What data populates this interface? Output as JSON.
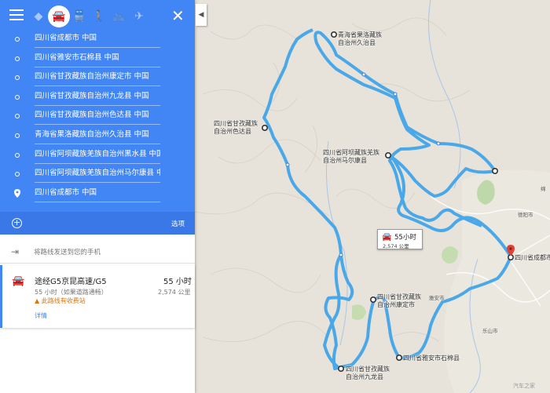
{
  "sidebar": {
    "close_label": "✕",
    "travel_modes": [
      {
        "name": "best",
        "icon": "diamond-route-icon"
      },
      {
        "name": "drive",
        "icon": "car-icon"
      },
      {
        "name": "transit",
        "icon": "train-icon"
      },
      {
        "name": "walk",
        "icon": "walk-icon"
      },
      {
        "name": "bike",
        "icon": "bike-icon"
      },
      {
        "name": "flight",
        "icon": "plane-icon"
      }
    ],
    "stops": [
      "四川省成都市 中国",
      "四川省雅安市石棉县 中国",
      "四川省甘孜藏族自治州康定市 中国",
      "四川省甘孜藏族自治州九龙县 中国",
      "四川省甘孜藏族自治州色达县 中国",
      "青海省果洛藏族自治州久治县 中国",
      "四川省阿坝藏族羌族自治州黑水县 中国",
      "四川省阿坝藏族羌族自治州马尔康县 中国",
      "四川省成都市 中国"
    ],
    "options_label": "选项",
    "send_label": "将路线发送到您的手机",
    "route": {
      "via": "途经G5京昆高速/G5",
      "duration": "55 小时",
      "traffic": "55 小时（如果道路通畅）",
      "distance": "2,574 公里",
      "warning": "此路线有收费站",
      "details": "详情"
    }
  },
  "map": {
    "info_time": "55小时",
    "info_distance": "2,574 公里",
    "places": [
      {
        "id": "jiuzhi",
        "line1": "青海省果洛藏族",
        "line2": "自治州久治县"
      },
      {
        "id": "seda",
        "line1": "四川省甘孜藏族",
        "line2": "自治州色达县"
      },
      {
        "id": "maerkang",
        "line1": "四川省阿坝藏族羌族",
        "line2": "自治州马尔康县"
      },
      {
        "id": "chengdu",
        "line1": "四川省成都市",
        "line2": ""
      },
      {
        "id": "kangding",
        "line1": "四川省甘孜藏族",
        "line2": "自治州康定市"
      },
      {
        "id": "shimian",
        "line1": "四川省雅安市石棉县",
        "line2": ""
      },
      {
        "id": "jiulong",
        "line1": "四川省甘孜藏族",
        "line2": "自治州九龙县"
      }
    ],
    "cities": [
      "德阳市",
      "雅安市",
      "乐山市",
      "绵"
    ],
    "watermark": "汽车之家"
  },
  "colors": {
    "accent": "#4285f4",
    "route": "#4aa8e8",
    "warning": "#e37400"
  }
}
